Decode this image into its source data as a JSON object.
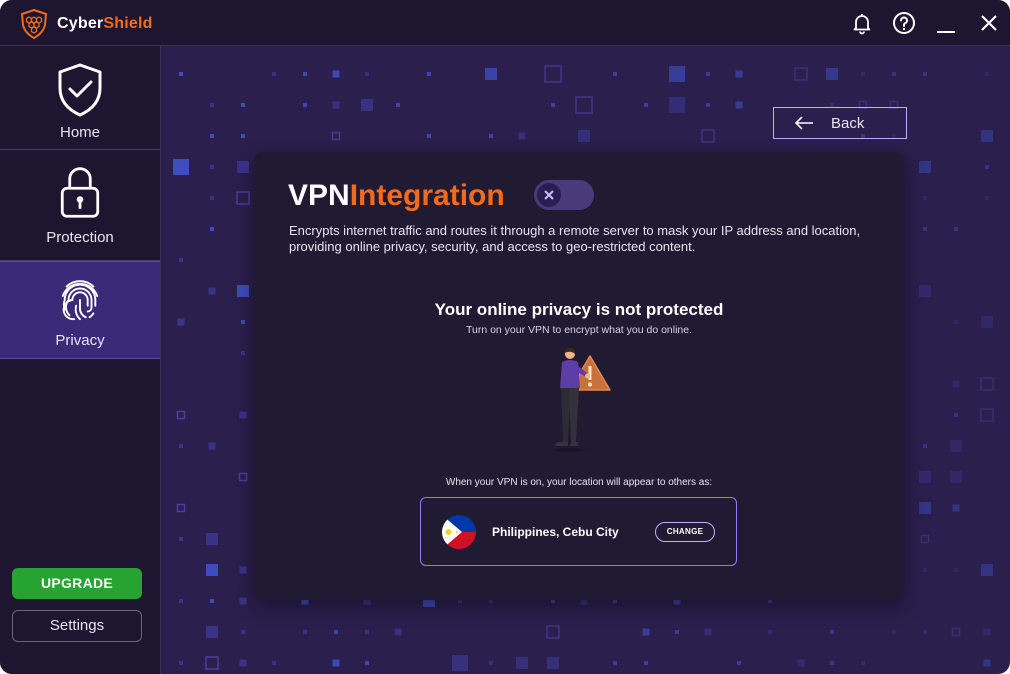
{
  "app": {
    "brand_part1": "Cyber",
    "brand_part2": "Shield",
    "icons": {
      "logo": "shield-hex-logo",
      "notifications": "bell-icon",
      "help": "help-icon",
      "minimize": "minimize-icon",
      "close": "close-icon"
    }
  },
  "sidebar": {
    "items": [
      {
        "label": "Home",
        "icon": "shield-check-icon"
      },
      {
        "label": "Protection",
        "icon": "padlock-icon"
      },
      {
        "label": "Privacy",
        "icon": "fingerprint-icon",
        "active": true
      }
    ],
    "upgrade_label": "UPGRADE",
    "settings_label": "Settings"
  },
  "main": {
    "back_label": "Back",
    "title_part1": "VPN",
    "title_part2": "Integration",
    "vpn_enabled": false,
    "description": "Encrypts internet traffic and routes it through a remote server to mask your IP address and location, providing online privacy, security, and access to geo-restricted content.",
    "status_title": "Your online privacy is not protected",
    "status_subtitle": "Turn on your VPN to encrypt what you do online.",
    "location_note": "When your VPN is on, your location will appear to others as:",
    "location": "Philippines, Cebu City",
    "change_label": "CHANGE"
  },
  "colors": {
    "accent": "#f26b1d",
    "upgrade": "#27a331",
    "background": "#2a1f4d",
    "panel": "#211a33",
    "active_nav": "#3a2a78"
  }
}
